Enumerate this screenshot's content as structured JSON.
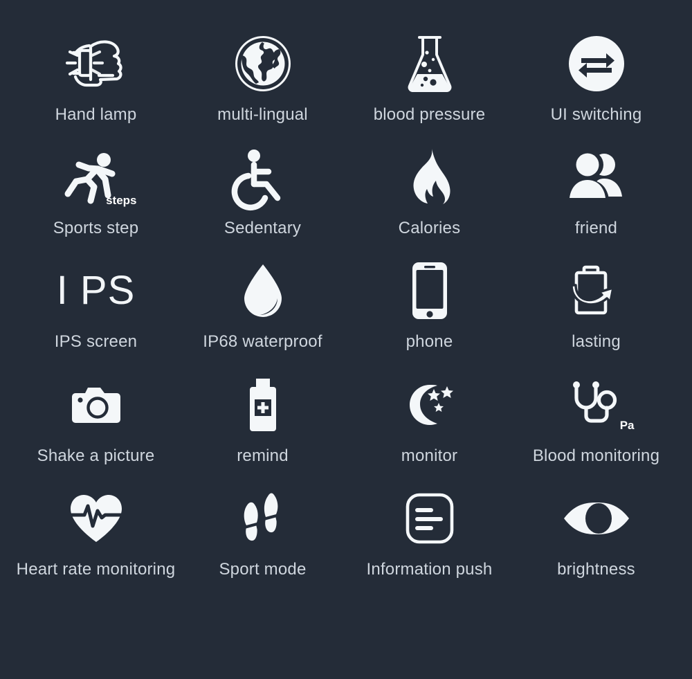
{
  "page": {
    "background_color": "#242c38",
    "icon_color": "#f4f7f9",
    "label_color": "#cfd6de",
    "columns": 4,
    "rows": 5
  },
  "features": [
    {
      "id": "hand-lamp",
      "label": "Hand lamp",
      "icon": "fist-watch-lamp-icon"
    },
    {
      "id": "multi-lingual",
      "label": "multi-lingual",
      "icon": "globe-icon"
    },
    {
      "id": "blood-pressure",
      "label": "blood pressure",
      "icon": "flask-icon"
    },
    {
      "id": "ui-switching",
      "label": "UI switching",
      "icon": "swap-arrows-circle-icon"
    },
    {
      "id": "sports-step",
      "label": "Sports step",
      "icon": "running-person-icon",
      "badge": "steps"
    },
    {
      "id": "sedentary",
      "label": "Sedentary",
      "icon": "wheelchair-icon"
    },
    {
      "id": "calories",
      "label": "Calories",
      "icon": "flame-icon"
    },
    {
      "id": "friend",
      "label": "friend",
      "icon": "two-people-icon"
    },
    {
      "id": "ips-screen",
      "label": "IPS screen",
      "icon": "ips-text-icon",
      "glyph_text": "I PS"
    },
    {
      "id": "ip68-waterproof",
      "label": "IP68 waterproof",
      "icon": "water-drop-icon"
    },
    {
      "id": "phone",
      "label": "phone",
      "icon": "smartphone-icon"
    },
    {
      "id": "lasting",
      "label": "lasting",
      "icon": "battery-recharge-icon"
    },
    {
      "id": "shake-a-picture",
      "label": "Shake a picture",
      "icon": "camera-icon"
    },
    {
      "id": "remind",
      "label": "remind",
      "icon": "medicine-bottle-icon"
    },
    {
      "id": "monitor",
      "label": "monitor",
      "icon": "moon-stars-icon"
    },
    {
      "id": "blood-monitoring",
      "label": "Blood monitoring",
      "icon": "stethoscope-icon",
      "badge": "Pa"
    },
    {
      "id": "heart-rate-monitoring",
      "label": "Heart rate monitoring",
      "icon": "heart-pulse-icon"
    },
    {
      "id": "sport-mode",
      "label": "Sport mode",
      "icon": "footprints-icon"
    },
    {
      "id": "information-push",
      "label": "Information push",
      "icon": "document-lines-icon"
    },
    {
      "id": "brightness",
      "label": "brightness",
      "icon": "eye-icon"
    }
  ]
}
